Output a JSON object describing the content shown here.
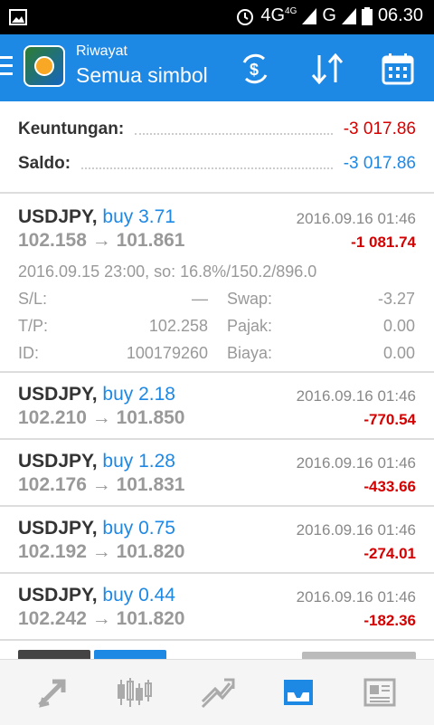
{
  "status": {
    "network": "4G",
    "network_small": "4G",
    "carrier": "G",
    "time": "06.30"
  },
  "header": {
    "subtitle": "Riwayat",
    "title": "Semua simbol"
  },
  "summary": {
    "profit_label": "Keuntungan:",
    "profit_value": "-3 017.86",
    "balance_label": "Saldo:",
    "balance_value": "-3 017.86"
  },
  "colors": {
    "accent": "#1e88e5",
    "loss": "#d50000"
  },
  "trades": [
    {
      "symbol": "USDJPY,",
      "type": "buy 3.71",
      "time": "2016.09.16 01:46",
      "prices": "102.158 → 101.861",
      "profit": "-1 081.74",
      "expanded": {
        "open": "2016.09.15 23:00, so: 16.8%/150.2/896.0",
        "sl_label": "S/L:",
        "sl": "—",
        "swap_label": "Swap:",
        "swap": "-3.27",
        "tp_label": "T/P:",
        "tp": "102.258",
        "tax_label": "Pajak:",
        "tax": "0.00",
        "id_label": "ID:",
        "id": "100179260",
        "fee_label": "Biaya:",
        "fee": "0.00"
      }
    },
    {
      "symbol": "USDJPY,",
      "type": "buy 2.18",
      "time": "2016.09.16 01:46",
      "prices": "102.210 → 101.850",
      "profit": "-770.54"
    },
    {
      "symbol": "USDJPY,",
      "type": "buy 1.28",
      "time": "2016.09.16 01:46",
      "prices": "102.176 → 101.831",
      "profit": "-433.66"
    },
    {
      "symbol": "USDJPY,",
      "type": "buy 0.75",
      "time": "2016.09.16 01:46",
      "prices": "102.192 → 101.820",
      "profit": "-274.01"
    },
    {
      "symbol": "USDJPY,",
      "type": "buy 0.44",
      "time": "2016.09.16 01:46",
      "prices": "102.242 → 101.820",
      "profit": "-182.36"
    }
  ],
  "nav": [
    "quotes-icon",
    "chart-icon",
    "trade-icon",
    "history-icon",
    "news-icon"
  ]
}
